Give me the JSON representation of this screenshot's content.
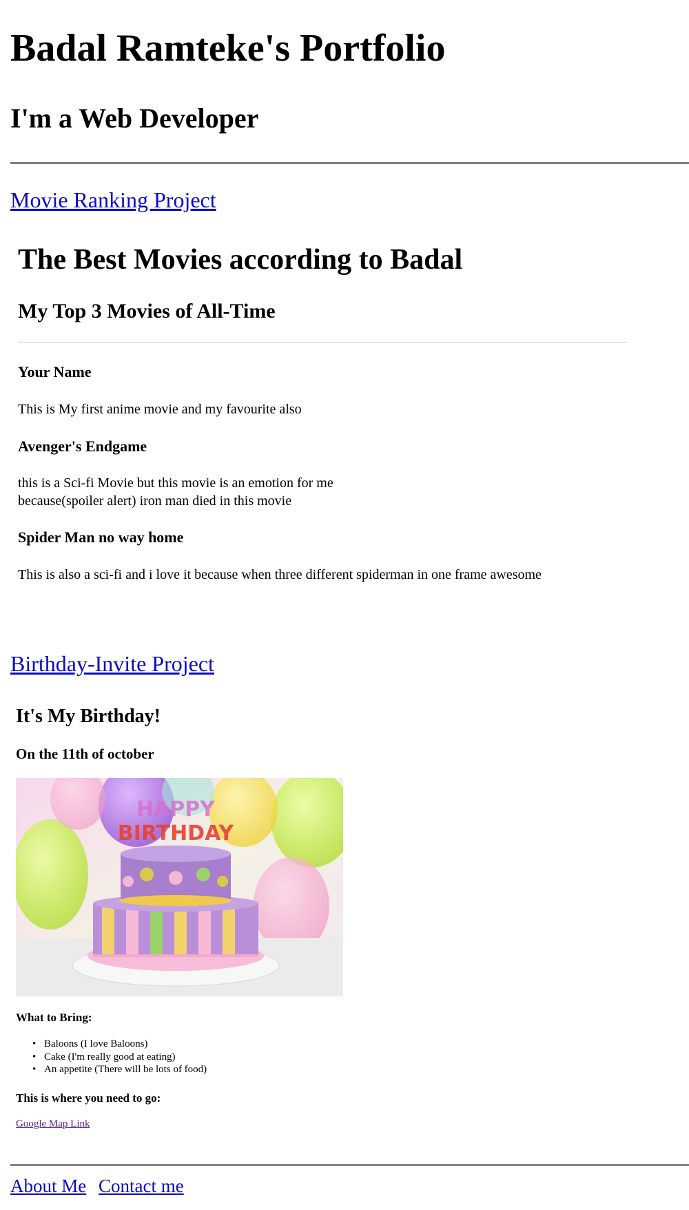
{
  "header": {
    "title": "Badal Ramteke's Portfolio",
    "subtitle": "I'm a Web Developer"
  },
  "movie_project": {
    "link_label": "Movie Ranking Project",
    "heading": "The Best Movies according to Badal",
    "subheading": "My Top 3 Movies of All-Time",
    "movies": [
      {
        "title": "Your Name",
        "description": [
          "This is My first anime movie and my favourite also"
        ]
      },
      {
        "title": "Avenger's Endgame",
        "description": [
          "this is a Sci-fi Movie but this movie is an emotion for me",
          "because(spoiler alert) iron man died in this movie"
        ]
      },
      {
        "title": "Spider Man no way home",
        "description": [
          "This is also a sci-fi and i love it because when three different spiderman in one frame awesome"
        ]
      }
    ]
  },
  "birthday_project": {
    "link_label": "Birthday-Invite Project",
    "heading": "It's My Birthday!",
    "date": "On the 11th of october",
    "image_text": [
      "HAPPY",
      "BIRTHDAY"
    ],
    "bring_heading": "What to Bring:",
    "bring_items": [
      "Baloons (I love Baloons)",
      "Cake (I'm really good at eating)",
      "An appetite (There will be lots of food)"
    ],
    "where_heading": "This is where you need to go:",
    "map_link_label": "Google Map Link"
  },
  "footer": {
    "about_label": "About Me",
    "contact_label": "Contact me"
  },
  "colors": {
    "link": "#0a0acc",
    "visited_link": "#551a8b",
    "rule": "#808080"
  }
}
